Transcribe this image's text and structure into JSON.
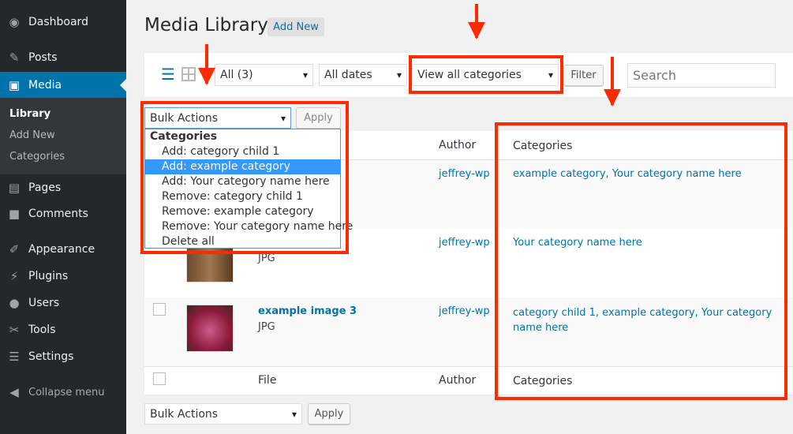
{
  "sidebar": {
    "items": [
      {
        "label": "Dashboard",
        "icon": "dashboard-icon"
      },
      {
        "label": "Posts",
        "icon": "pin-icon"
      },
      {
        "label": "Media",
        "icon": "media-icon"
      },
      {
        "label": "Pages",
        "icon": "pages-icon"
      },
      {
        "label": "Comments",
        "icon": "comment-icon"
      },
      {
        "label": "Appearance",
        "icon": "brush-icon"
      },
      {
        "label": "Plugins",
        "icon": "plug-icon"
      },
      {
        "label": "Users",
        "icon": "user-icon"
      },
      {
        "label": "Tools",
        "icon": "wrench-icon"
      },
      {
        "label": "Settings",
        "icon": "settings-icon"
      }
    ],
    "submenu": [
      "Library",
      "Add New",
      "Categories"
    ],
    "collapse": "Collapse menu"
  },
  "header": {
    "title": "Media Library",
    "add_new": "Add New"
  },
  "toolbar": {
    "type_filter": "All (3)",
    "date_filter": "All dates",
    "category_filter": "View all categories",
    "filter_button": "Filter",
    "search_placeholder": "Search"
  },
  "bulk": {
    "label": "Bulk Actions",
    "apply": "Apply",
    "dropdown": {
      "group": "Categories",
      "options": [
        "Add: category child 1",
        "Add: example category",
        "Add: Your category name here",
        "Remove: category child 1",
        "Remove: example category",
        "Remove: Your category name here",
        "Delete all"
      ],
      "highlighted": "Add: example category"
    }
  },
  "table": {
    "columns": {
      "file": "File",
      "author": "Author",
      "categories": "Categories"
    },
    "rows": [
      {
        "title": "",
        "type": "",
        "author": "jeffrey-wp",
        "categories": "example category, Your category name here"
      },
      {
        "title": "",
        "type": "JPG",
        "author": "jeffrey-wp",
        "categories": "Your category name here"
      },
      {
        "title": "example image 3",
        "type": "JPG",
        "author": "jeffrey-wp",
        "categories": "category child 1, example category, Your category name here"
      }
    ]
  },
  "colors": {
    "accent": "#0073aa",
    "annotation": "#ff2a00",
    "sidebar": "#23282d"
  }
}
